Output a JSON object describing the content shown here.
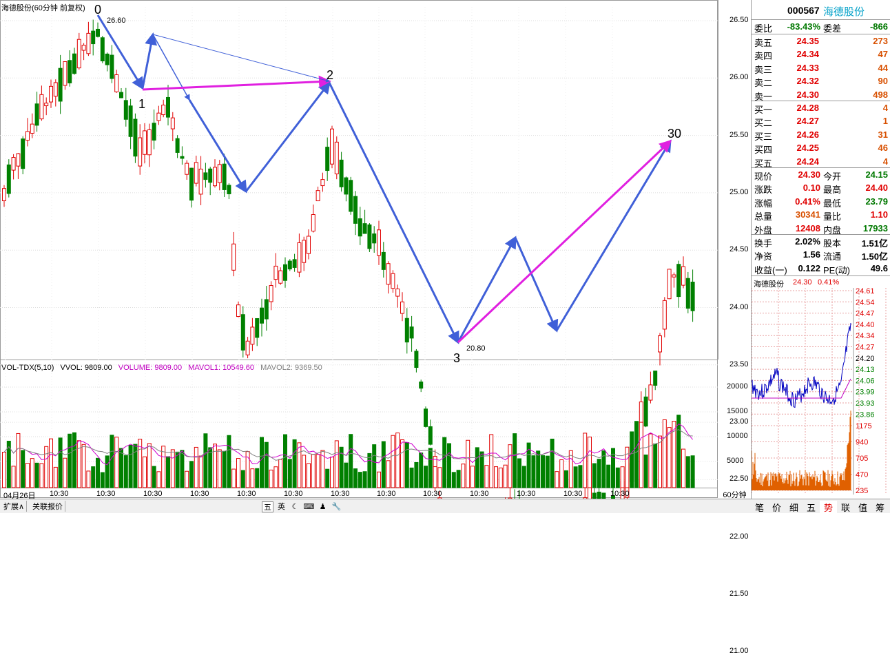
{
  "chart_title": "海德股份(60分钟 前复权)",
  "price_axis": [
    "26.50",
    "26.00",
    "25.50",
    "25.00",
    "24.50",
    "24.00",
    "23.50",
    "23.00",
    "22.50",
    "22.00",
    "21.50",
    "21.00"
  ],
  "annotations": {
    "high_value": "26.60",
    "low_value": "20.80",
    "points": [
      "0",
      "1",
      "2",
      "3",
      "30"
    ]
  },
  "volume_legend": {
    "name": "VOL-TDX(5,10)",
    "vvol": "VVOL: 9809.00",
    "volume": "VOLUME: 9809.00",
    "mavol1": "MAVOL1: 10549.60",
    "mavol2": "MAVOL2: 9369.50"
  },
  "volume_axis": [
    "20000",
    "15000",
    "10000",
    "5000"
  ],
  "x_labels": [
    "04月26日",
    "10:30",
    "10:30",
    "10:30",
    "10:30",
    "10:30",
    "10:30",
    "10:30",
    "10:30",
    "10:30",
    "10:30",
    "10:30",
    "10:30",
    "10:30"
  ],
  "period": "60分钟",
  "bottom_tabs": [
    "扩展∧",
    "关联报价"
  ],
  "toolbar": [
    "五",
    "英",
    "☾",
    "⌨",
    "♟",
    "🔧"
  ],
  "quote": {
    "code": "000567",
    "name": "海德股份",
    "weibi_label": "委比",
    "weibi": "-83.43%",
    "weicha_label": "委差",
    "weicha": "-866",
    "asks": [
      {
        "label": "卖五",
        "price": "24.35",
        "vol": "273"
      },
      {
        "label": "卖四",
        "price": "24.34",
        "vol": "47"
      },
      {
        "label": "卖三",
        "price": "24.33",
        "vol": "44"
      },
      {
        "label": "卖二",
        "price": "24.32",
        "vol": "90"
      },
      {
        "label": "卖一",
        "price": "24.30",
        "vol": "498"
      }
    ],
    "bids": [
      {
        "label": "买一",
        "price": "24.28",
        "vol": "4"
      },
      {
        "label": "买二",
        "price": "24.27",
        "vol": "1"
      },
      {
        "label": "买三",
        "price": "24.26",
        "vol": "31"
      },
      {
        "label": "买四",
        "price": "24.25",
        "vol": "46"
      },
      {
        "label": "买五",
        "price": "24.24",
        "vol": "4"
      }
    ],
    "stats": [
      {
        "l1": "现价",
        "v1": "24.30",
        "l2": "今开",
        "v2": "24.15"
      },
      {
        "l1": "涨跌",
        "v1": "0.10",
        "l2": "最高",
        "v2": "24.40"
      },
      {
        "l1": "涨幅",
        "v1": "0.41%",
        "l2": "最低",
        "v2": "23.79"
      },
      {
        "l1": "总量",
        "v1": "30341",
        "l2": "量比",
        "v2": "1.10"
      },
      {
        "l1": "外盘",
        "v1": "12408",
        "l2": "内盘",
        "v2": "17933"
      }
    ],
    "fin": [
      {
        "l1": "换手",
        "v1": "2.02%",
        "l2": "股本",
        "v2": "1.51亿"
      },
      {
        "l1": "净资",
        "v1": "1.56",
        "l2": "流通",
        "v2": "1.50亿"
      },
      {
        "l1": "收益(一)",
        "v1": "0.122",
        "l2": "PE(动)",
        "v2": "49.6"
      }
    ]
  },
  "mini_chart": {
    "title": "海德股份",
    "price": "24.30",
    "pct": "0.41%",
    "price_labels": [
      "24.61",
      "24.54",
      "24.47",
      "24.40",
      "24.34",
      "24.27",
      "24.20",
      "24.13",
      "24.06",
      "23.99",
      "23.93",
      "23.86"
    ],
    "vol_labels": [
      "1175",
      "940",
      "705",
      "470",
      "235"
    ]
  },
  "right_tabs": [
    "笔",
    "价",
    "细",
    "五",
    "势",
    "联",
    "值",
    "筹"
  ],
  "colors": {
    "up": "#e00000",
    "down": "#008000",
    "arrow_blue": "#4060d8",
    "arrow_magenta": "#e020e0"
  }
}
